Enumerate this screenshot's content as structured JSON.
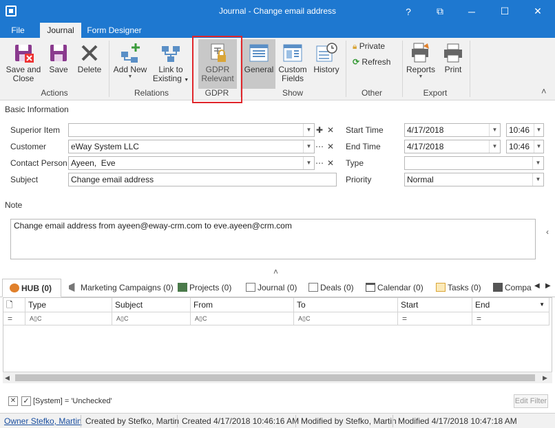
{
  "window": {
    "title": "Journal - Change email address",
    "help": "?",
    "restore": "⧉",
    "minimize": "─",
    "maximize": "☐",
    "close": "✕"
  },
  "app_tabs": [
    {
      "label": "File"
    },
    {
      "label": "Journal"
    },
    {
      "label": "Form Designer"
    }
  ],
  "ribbon": {
    "save_close": "Save and\nClose",
    "save": "Save",
    "delete": "Delete",
    "actions_group": "Actions",
    "add_new": "Add New",
    "link_existing": "Link to\nExisting",
    "relations_group": "Relations",
    "gdpr_relevant": "GDPR\nRelevant",
    "gdpr_group": "GDPR",
    "general": "General",
    "custom_fields": "Custom\nFields",
    "history": "History",
    "show_group": "Show",
    "private": "Private",
    "refresh": "Refresh",
    "other_group": "Other",
    "reports": "Reports",
    "print": "Print",
    "export_group": "Export",
    "collapse": "˄"
  },
  "basic_info": {
    "section_title": "Basic Information",
    "superior_item_label": "Superior Item",
    "superior_item_value": "",
    "customer_label": "Customer",
    "customer_value": "eWay System LLC",
    "contact_person_label": "Contact Person",
    "contact_person_value": "Ayeen,  Eve",
    "subject_label": "Subject",
    "subject_value": "Change email address",
    "start_time_label": "Start Time",
    "start_date": "4/17/2018",
    "start_clock": "10:46",
    "end_time_label": "End Time",
    "end_date": "4/17/2018",
    "end_clock": "10:46",
    "type_label": "Type",
    "type_value": "",
    "priority_label": "Priority",
    "priority_value": "Normal"
  },
  "note": {
    "label": "Note",
    "value": "Change email address from ayeen@eway-crm.com to eve.ayeen@crm.com"
  },
  "tabs": [
    {
      "label": "HUB (0)"
    },
    {
      "label": "Marketing Campaigns (0)"
    },
    {
      "label": "Projects (0)"
    },
    {
      "label": "Journal (0)"
    },
    {
      "label": "Deals (0)"
    },
    {
      "label": "Calendar (0)"
    },
    {
      "label": "Tasks (0)"
    },
    {
      "label": "Compa"
    }
  ],
  "grid": {
    "columns": [
      "Type",
      "Subject",
      "From",
      "To",
      "Start",
      "End"
    ],
    "filter_text_glyph": "A▯C",
    "filter_eq_glyph": "="
  },
  "filter_bar": {
    "expression": "[System] = 'Unchecked'",
    "edit_filter": "Edit Filter"
  },
  "status": {
    "owner_prefix": "Owner",
    "owner": "Stefko, Martin",
    "created_by": "Created by Stefko, Martin",
    "created": "Created 4/17/2018 10:46:16 AM",
    "modified_by": "Modified by Stefko, Martin",
    "modified": "Modified 4/17/2018 10:47:18 AM"
  },
  "colors": {
    "accent": "#1e78d0",
    "highlight": "#e0262b"
  }
}
